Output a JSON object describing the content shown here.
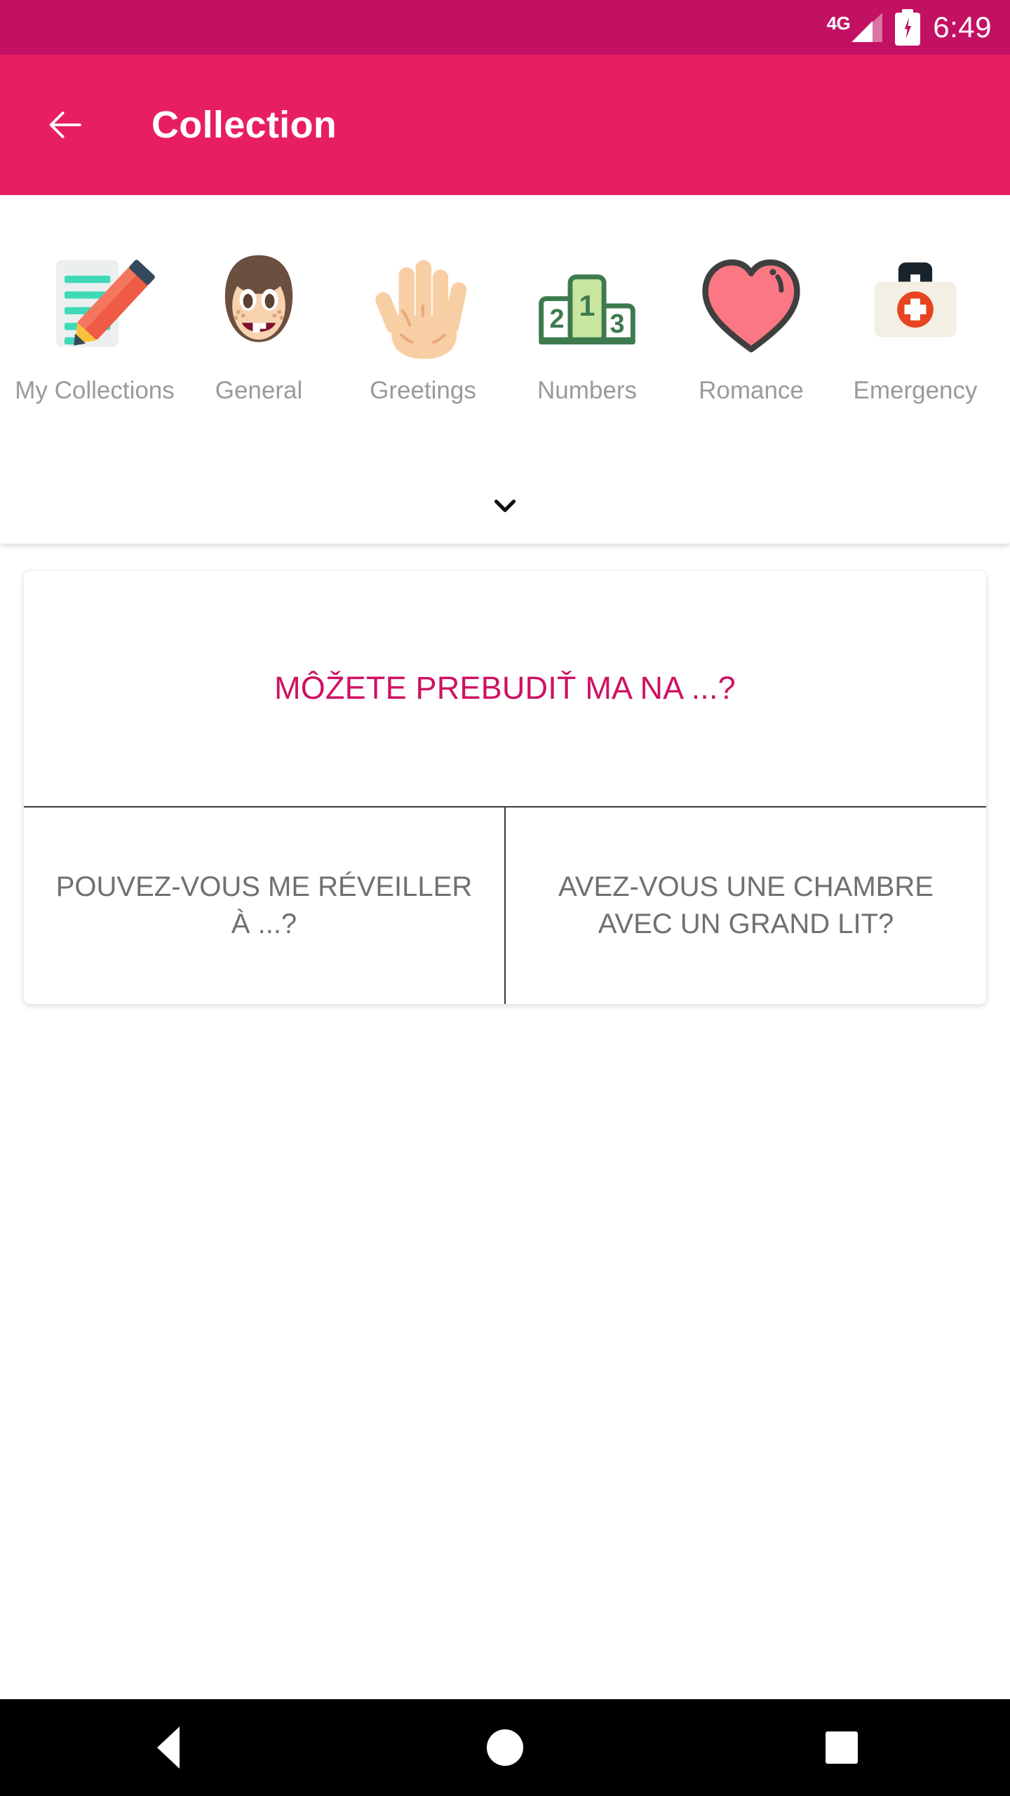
{
  "status_bar": {
    "network_label": "4G",
    "signal_icon": "signal-bars-icon",
    "battery_icon": "battery-charging-icon",
    "time": "6:49"
  },
  "app_bar": {
    "back_icon": "back-arrow-icon",
    "title": "Collection"
  },
  "categories": {
    "expander_icon": "chevron-down-icon",
    "items": [
      {
        "label": "My Collections",
        "icon": "memo-pencil-icon"
      },
      {
        "label": "General",
        "icon": "girl-face-icon"
      },
      {
        "label": "Greetings",
        "icon": "open-hand-icon"
      },
      {
        "label": "Numbers",
        "icon": "podium-icon"
      },
      {
        "label": "Romance",
        "icon": "heart-icon"
      },
      {
        "label": "Emergency",
        "icon": "first-aid-kit-icon"
      }
    ]
  },
  "phrase_card": {
    "main_phrase": "MÔŽETE PREBUDIŤ MA NA ...?",
    "options": [
      "POUVEZ-VOUS ME RÉVEILLER À ...?",
      "AVEZ-VOUS UNE CHAMBRE AVEC UN GRAND LIT?"
    ]
  },
  "nav_bar": {
    "back_icon": "nav-back-triangle-icon",
    "home_icon": "nav-home-circle-icon",
    "recents_icon": "nav-recents-square-icon"
  },
  "colors": {
    "status_bar": "#c21162",
    "app_bar": "#e81e63",
    "phrase_accent": "#ce1263",
    "option_text": "#707070",
    "category_label": "#9a9a9a"
  }
}
